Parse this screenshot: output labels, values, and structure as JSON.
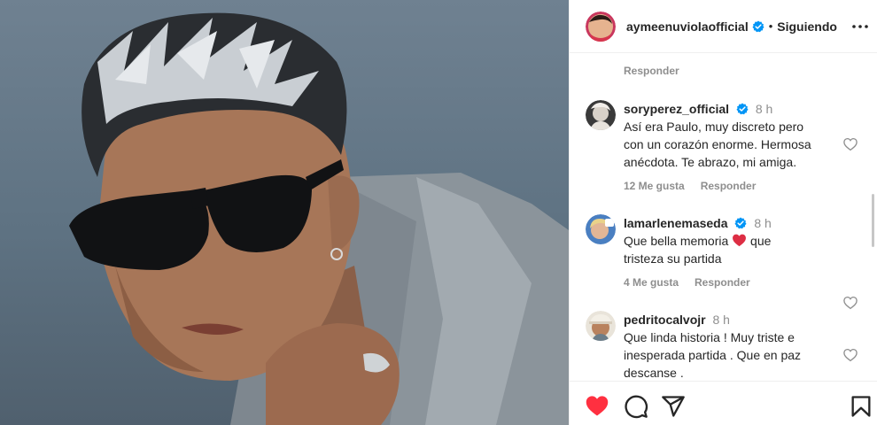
{
  "post": {
    "username": "aymeenuviolaofficial",
    "separator": "•",
    "follow_state": "Siguiendo"
  },
  "thread": {
    "reply_label_top": "Responder"
  },
  "comments": [
    {
      "username": "soryperez_official",
      "verified": true,
      "time": "8 h",
      "text": "Así era Paulo, muy discreto pero con un corazón enorme. Hermosa anécdota. Te abrazo, mi amiga.",
      "likes": "12 Me gusta",
      "reply": "Responder"
    },
    {
      "username": "lamarlenemaseda",
      "verified": true,
      "time": "8 h",
      "text_before": "Que bella memoria",
      "text_after": " que tristeza su partida",
      "likes": "4 Me gusta",
      "reply": "Responder"
    },
    {
      "username": "pedritocalvojr",
      "verified": false,
      "time": "8 h",
      "text": "Que linda historia ! Muy triste e inesperada partida . Que en paz descanse ."
    }
  ],
  "icons": {
    "verified": "verified-badge-icon",
    "more": "more-options-icon",
    "like": "heart-icon",
    "comment": "comment-icon",
    "share": "share-icon",
    "save": "bookmark-icon"
  },
  "colors": {
    "liked": "#ff3040",
    "verified": "#0095f6",
    "muted": "#8e8e8e"
  }
}
